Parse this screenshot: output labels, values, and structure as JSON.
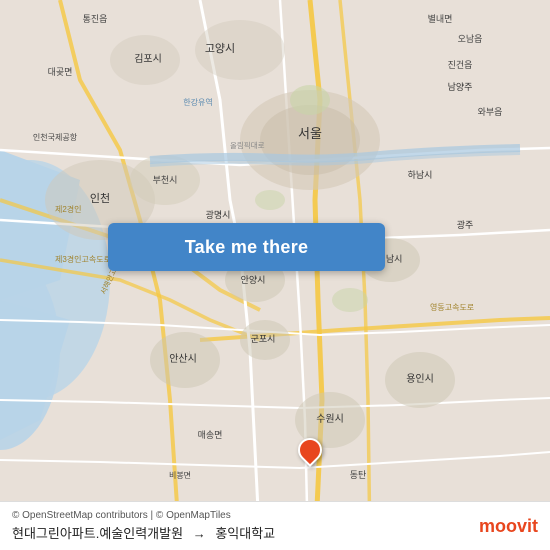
{
  "map": {
    "background_color": "#e8e0d8",
    "attribution": "© OpenStreetMap contributors | © OpenMapTiles"
  },
  "button": {
    "label": "Take me there",
    "arrow": "→",
    "background_color": "#4285c8"
  },
  "footer": {
    "attribution": "© OpenStreetMap contributors | © OpenMapTiles",
    "route_from": "현대그린아파트.예술인력개발원",
    "route_to": "홍익대학교",
    "route_separator": "→",
    "logo_text": "moovit"
  },
  "pin": {
    "color": "#e8461e"
  }
}
